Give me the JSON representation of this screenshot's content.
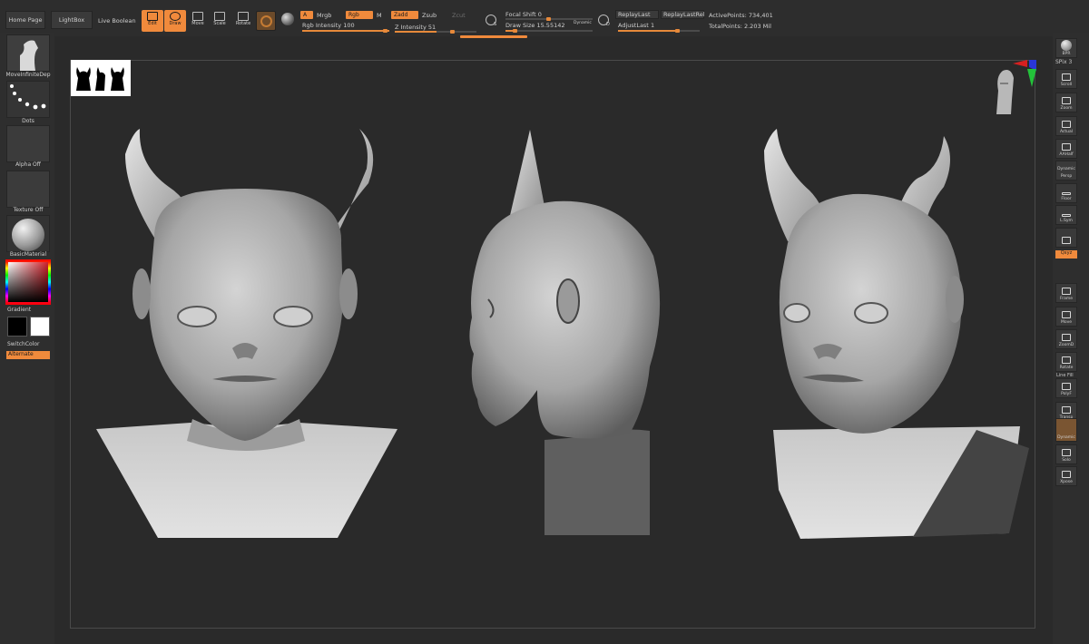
{
  "topbar": {
    "home_page": "Home Page",
    "lightbox": "LightBox",
    "live_boolean": "Live Boolean",
    "tools": {
      "edit": "Edit",
      "draw": "Draw",
      "move": "Move",
      "scale": "Scale",
      "rotate": "Rotate"
    },
    "material_toggle": {
      "a_label": "A",
      "mrgb": "Mrgb",
      "rgb": "Rgb",
      "m": "M",
      "zadd": "Zadd",
      "zsub": "Zsub",
      "zcut": "Zcut"
    },
    "rgb_intensity": {
      "label": "Rgb Intensity",
      "value": "100"
    },
    "z_intensity": {
      "label": "Z Intensity",
      "value": "51"
    },
    "focal_shift": {
      "label": "Focal Shift",
      "value": "0"
    },
    "draw_size": {
      "label": "Draw Size",
      "value": "15.55142"
    },
    "dynamic": "Dynamic",
    "s_label": "S",
    "d_label": "D",
    "replay_last": "ReplayLast",
    "replay_last_rel": "ReplayLastRel",
    "adjust_last": {
      "label": "AdjustLast",
      "value": "1"
    },
    "active_points": {
      "label": "ActivePoints:",
      "value": "734,401"
    },
    "total_points": {
      "label": "TotalPoints:",
      "value": "2.203 Mil"
    }
  },
  "left_shelf": {
    "brush": "MoveInfiniteDep",
    "stroke": "Dots",
    "alpha": "Alpha Off",
    "texture": "Texture Off",
    "material": "BasicMaterial",
    "gradient": "Gradient",
    "switch_color": "SwitchColor",
    "alternate": "Alternate"
  },
  "right_shelf": {
    "items": [
      "BPR",
      "SPix",
      "Scroll",
      "Zoom",
      "Actual",
      "AAHalf",
      "Persp",
      "Floor",
      "L.Sym",
      "Lock",
      "Qxyz",
      "Frame",
      "Move",
      "ZoomD",
      "Rotate",
      "Line Fill",
      "PolyF",
      "Transp",
      "Dynamic",
      "Solo",
      "Xpose"
    ],
    "spix_value": "3",
    "dynamic_caption": "Dynamic"
  },
  "colors": {
    "accent": "#f08a3c",
    "canvas_bg": "#2a2a2a",
    "panel_bg": "#2e2e2e",
    "model_gray": "#8f8f8f"
  }
}
